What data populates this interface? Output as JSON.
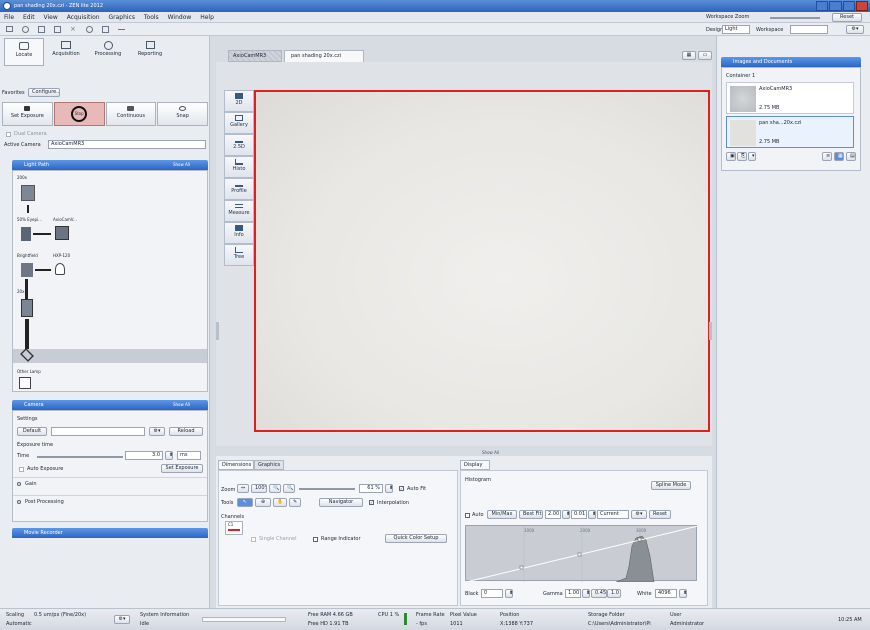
{
  "window": {
    "title": "pan shading 20x.czi - ZEN lite 2012",
    "zoom_label": "Workspace Zoom",
    "reset_label": "Reset"
  },
  "menu": [
    "File",
    "Edit",
    "View",
    "Acquisition",
    "Graphics",
    "Tools",
    "Window",
    "Help"
  ],
  "toolbar": {
    "design_label": "Design",
    "design_value": "Light",
    "workspace_label": "Workspace"
  },
  "left_tabs": [
    "Locate",
    "Acquisition",
    "Processing",
    "Reporting"
  ],
  "favorites": {
    "label": "Favorites",
    "configure": "Configure..."
  },
  "capture_buttons": [
    "Set Exposure",
    "Stop",
    "Continuous",
    "Snap"
  ],
  "dual_camera": "Dual Camera",
  "active_camera": {
    "label": "Active Camera",
    "value": "AxioCamMR3"
  },
  "light_path": {
    "title": "Light Path",
    "show_all": "Show All",
    "labels": [
      "200x",
      "50% Eyepi...",
      "AxioCamV...",
      "Brightfield",
      "HXP-120",
      "20x",
      "Other Lamp"
    ]
  },
  "camera_panel": {
    "title": "Camera",
    "show_all": "Show All",
    "settings_label": "Settings",
    "default_btn": "Default",
    "reload_btn": "Reload",
    "exposure_time_label": "Exposure time",
    "time_label": "Time",
    "time_value": "3.0",
    "time_unit": "ms",
    "auto_exposure": "Auto Exposure",
    "set_exposure": "Set Exposure",
    "gain": "Gain",
    "post_processing": "Post Processing"
  },
  "movie_recorder": {
    "title": "Movie Recorder"
  },
  "doc_tabs": [
    "AxioCamMR3",
    "pan shading 20x.czi"
  ],
  "view_tabs": [
    "2D",
    "Gallery",
    "2.5D",
    "Histo",
    "Profile",
    "Measure",
    "Info",
    "Tree"
  ],
  "bottom_tabs": {
    "left": [
      "Dimensions",
      "Graphics"
    ],
    "right": [
      "Display"
    ],
    "show_all": "Show All"
  },
  "dimensions": {
    "zoom_label": "Zoom",
    "zoom_value": "61 %",
    "zoom_100": "100%",
    "auto_fit": "Auto Fit",
    "tools_label": "Tools",
    "navigator": "Navigator",
    "interpolation": "Interpolation",
    "channels_label": "Channels",
    "channel_name": "C1",
    "single_channel": "Single Channel",
    "range_indicator": "Range Indicator",
    "quick_color_setup": "Quick Color Setup"
  },
  "display": {
    "histogram_label": "Histogram",
    "spline_mode": "Spline Mode",
    "auto": "Auto",
    "min_max": "Min/Max",
    "best_fit": "Best Fit",
    "best_fit_value": "2.00",
    "step_value": "0.01",
    "current": "Current",
    "reset": "Reset",
    "black_label": "Black",
    "black_value": "0",
    "gamma_label": "Gamma",
    "gamma_value": "1.00",
    "gamma_alt": "0.45",
    "gamma_alt2": "1.0",
    "white_label": "White",
    "white_value": "4096",
    "axis_labels": [
      "1000",
      "2000",
      "3000"
    ]
  },
  "images_docs": {
    "title": "Images and Documents",
    "container": "Container 1",
    "items": [
      {
        "name": "AxioCamMR3",
        "size": "2.75 MB"
      },
      {
        "name": "pan sha...20x.czi",
        "size": "2.75 MB"
      }
    ]
  },
  "status": {
    "scaling_label": "Scaling",
    "scaling_value": "0.5 um/px (Fine/20x)",
    "scaling_mode": "Automatic",
    "system_info": "System Information",
    "system_info2": "Idle",
    "free_ram": "Free RAM 4.66 GB",
    "free_hd": "Free HD  1.91 TB",
    "cpu": "CPU 1 %",
    "frame_rate": "Frame Rate",
    "frame_rate2": "- fps",
    "pixel_value": "Pixel Value",
    "pixel_value2": "1011",
    "position": "Position",
    "position2": "X:1388  Y:737",
    "storage_folder": "Storage Folder",
    "storage_path": "C:\\Users\\Administrator\\Pi",
    "user": "User",
    "user_name": "Administrator",
    "time": "10:25 AM"
  },
  "colors": {
    "accent": "#2b66c4",
    "image_border": "#e01f1f"
  }
}
